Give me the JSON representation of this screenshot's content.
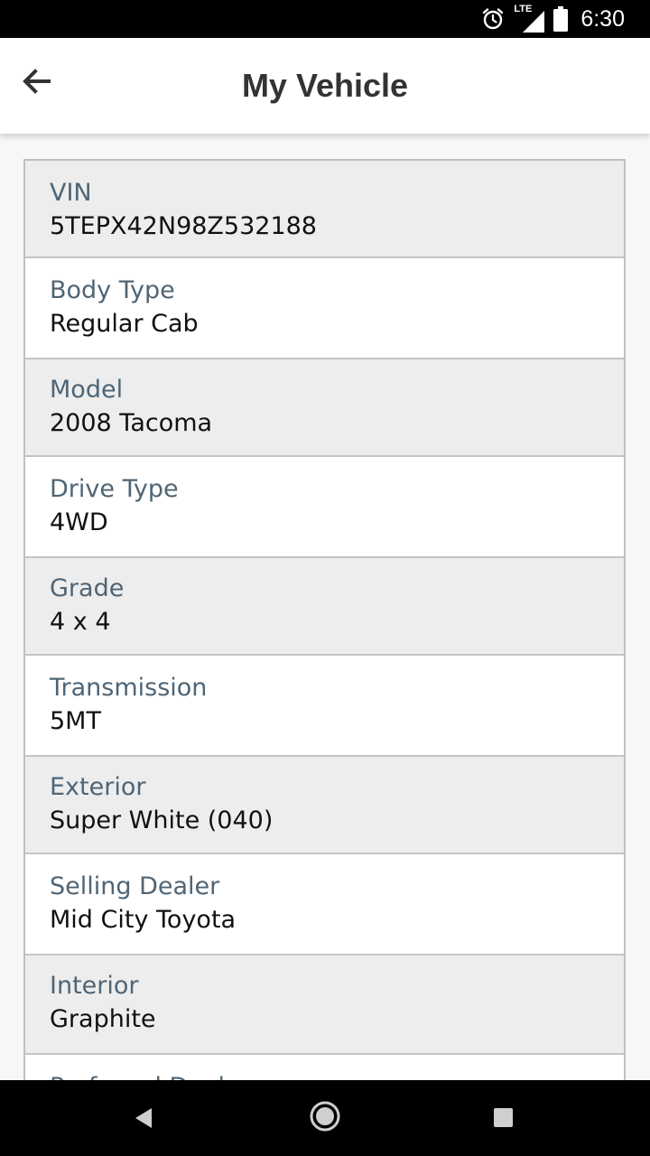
{
  "status_bar": {
    "time": "6:30",
    "network_label": "LTE",
    "icons": [
      "alarm-icon",
      "signal-icon",
      "battery-icon"
    ]
  },
  "app_bar": {
    "title": "My Vehicle",
    "back_icon": "arrow-left-icon"
  },
  "details": [
    {
      "label": "VIN",
      "value": "5TEPX42N98Z532188"
    },
    {
      "label": "Body Type",
      "value": "Regular Cab"
    },
    {
      "label": "Model",
      "value": "2008 Tacoma"
    },
    {
      "label": "Drive Type",
      "value": "4WD"
    },
    {
      "label": "Grade",
      "value": "4 x 4"
    },
    {
      "label": "Transmission",
      "value": "5MT"
    },
    {
      "label": "Exterior",
      "value": "Super White (040)"
    },
    {
      "label": "Selling Dealer",
      "value": "Mid City Toyota"
    },
    {
      "label": "Interior",
      "value": "Graphite"
    },
    {
      "label": "Preferred Dealer",
      "value": ""
    }
  ],
  "nav_bar": {
    "icons": [
      "back-triangle-icon",
      "home-circle-icon",
      "recents-square-icon"
    ]
  },
  "colors": {
    "label": "#4f6575",
    "value": "#111111",
    "row_shade": "#ededed",
    "border": "#c4c4c4"
  }
}
